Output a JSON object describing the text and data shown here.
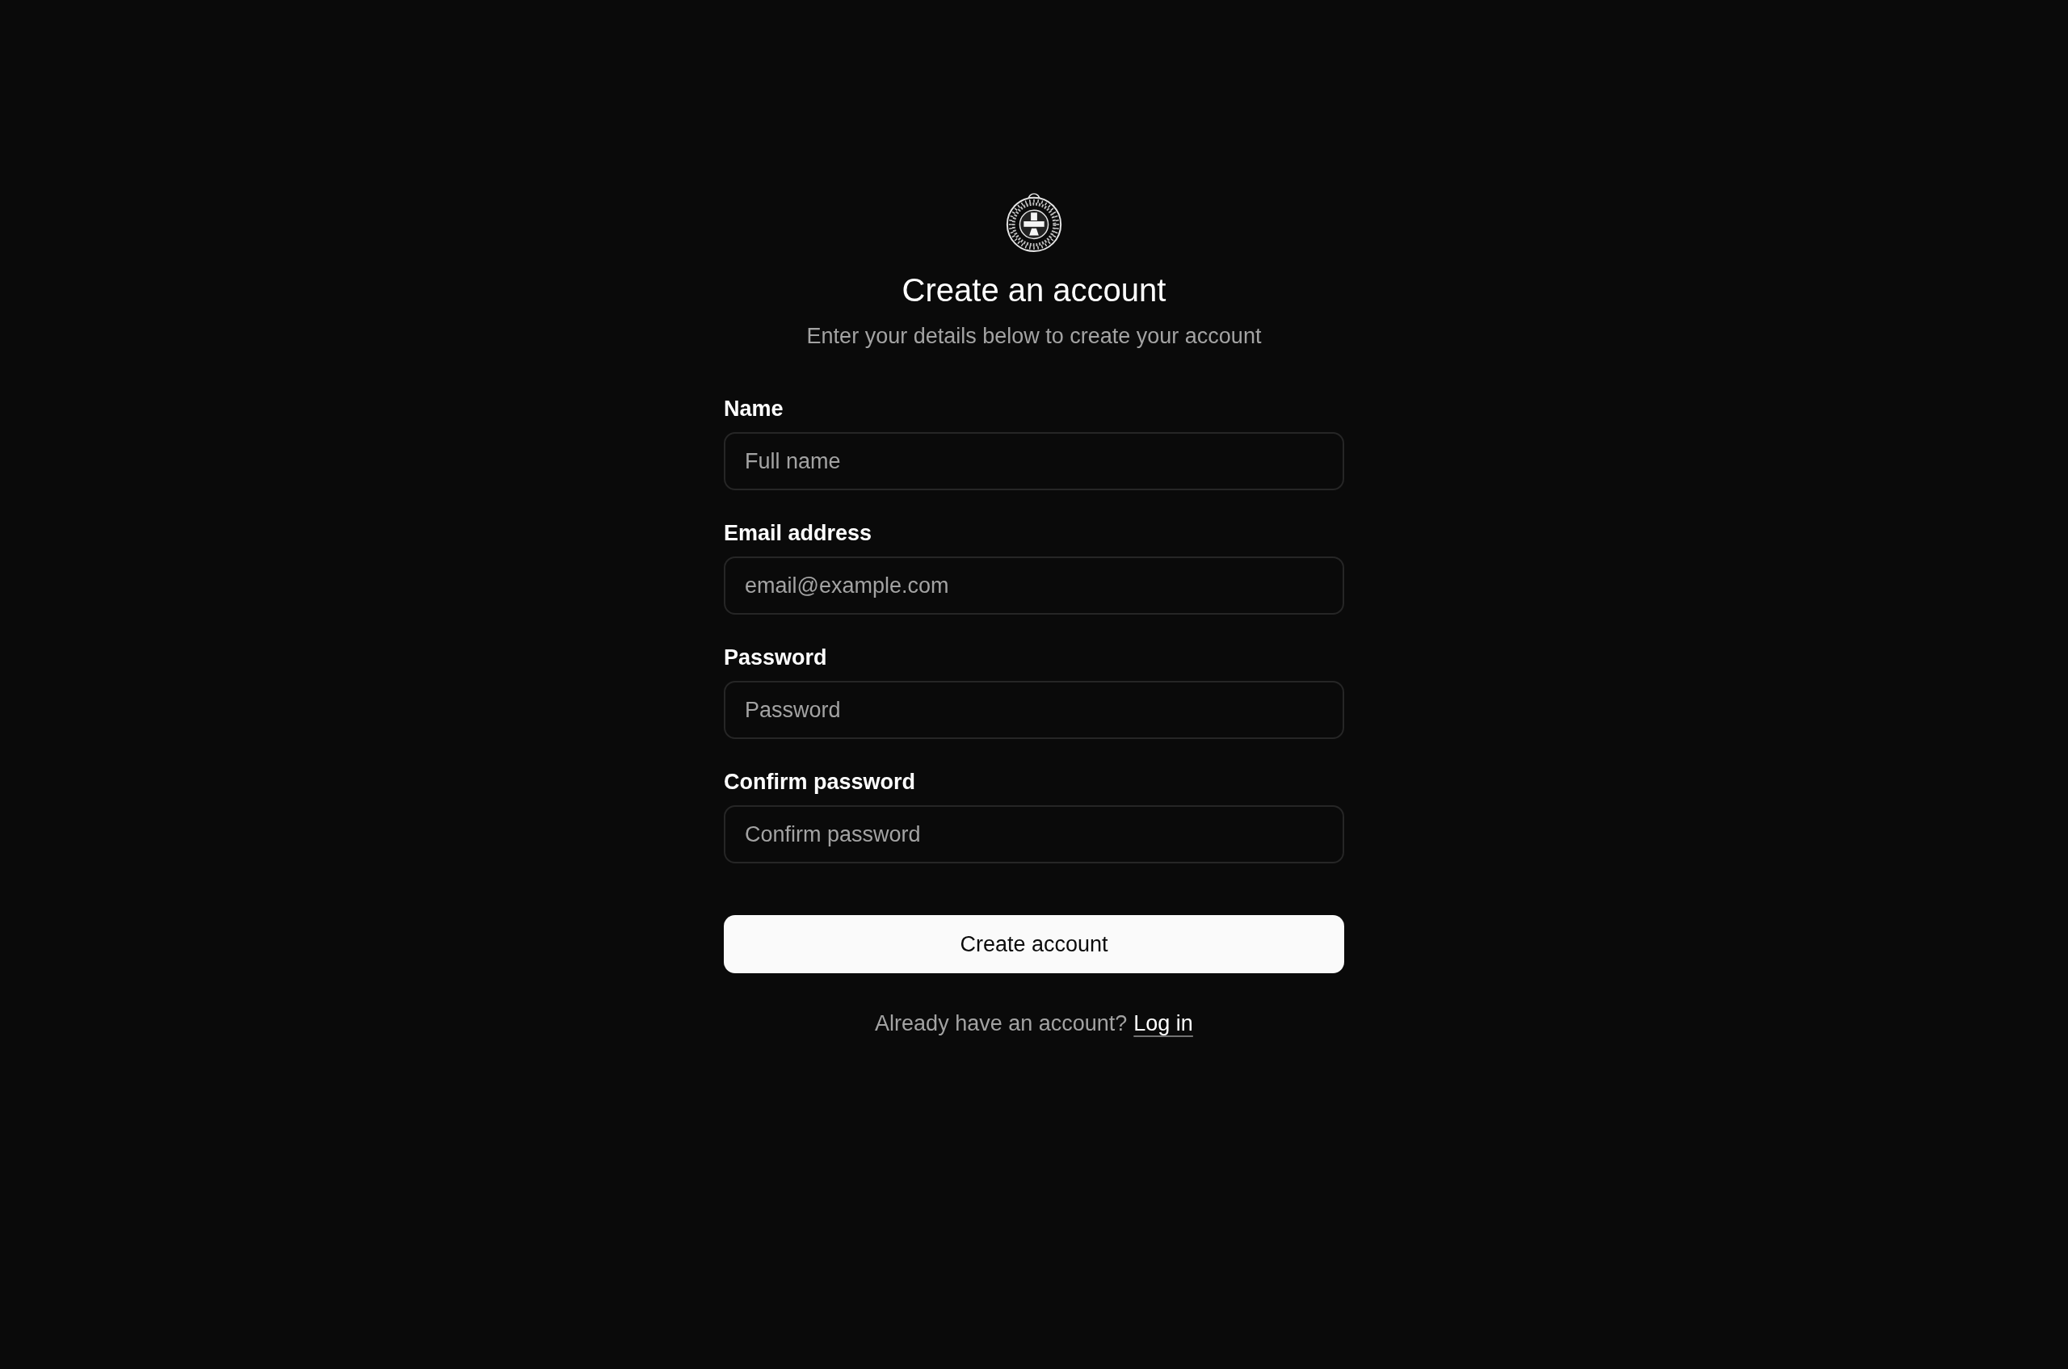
{
  "title": "Create an account",
  "subtitle": "Enter your details below to create your account",
  "fields": [
    {
      "label": "Name",
      "placeholder": "Full name"
    },
    {
      "label": "Email address",
      "placeholder": "email@example.com"
    },
    {
      "label": "Password",
      "placeholder": "Password"
    },
    {
      "label": "Confirm password",
      "placeholder": "Confirm password"
    }
  ],
  "submit_button": "Create account",
  "footer": {
    "text": "Already have an account?",
    "link": "Log in"
  }
}
